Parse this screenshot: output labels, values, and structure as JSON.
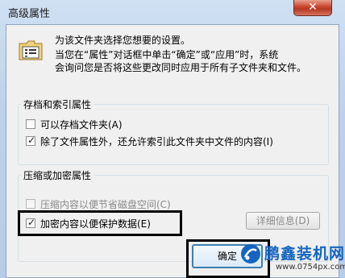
{
  "window": {
    "title": "高级属性",
    "close_glyph": "✕"
  },
  "description": {
    "line1": "为该文件夹选择您想要的设置。",
    "line2": "当您在“属性”对话框中单击“确定”或“应用”时，系统",
    "line3": "会询问您是否将这些更改同时应用于所有子文件夹和文件。"
  },
  "archive_index_group": {
    "label": "存档和索引属性",
    "archive_checkbox": {
      "label": "可以存档文件夹(A)",
      "checked": false
    },
    "index_checkbox": {
      "label": "除了文件属性外，还允许索引此文件夹中文件的内容(I)",
      "checked": true
    }
  },
  "compress_encrypt_group": {
    "label": "压缩或加密属性",
    "compress_checkbox": {
      "label": "压缩内容以便节省磁盘空间(C)",
      "checked": false,
      "disabled": true
    },
    "encrypt_checkbox": {
      "label": "加密内容以便保护数据(E)",
      "checked": true
    },
    "details_button": "详细信息(D)"
  },
  "buttons": {
    "ok": "确定"
  },
  "watermark": {
    "text": "鹏鑫装机网",
    "url": "www.0754px.com"
  },
  "icons": {
    "folder": "folder-properties-icon",
    "check": "✓"
  }
}
